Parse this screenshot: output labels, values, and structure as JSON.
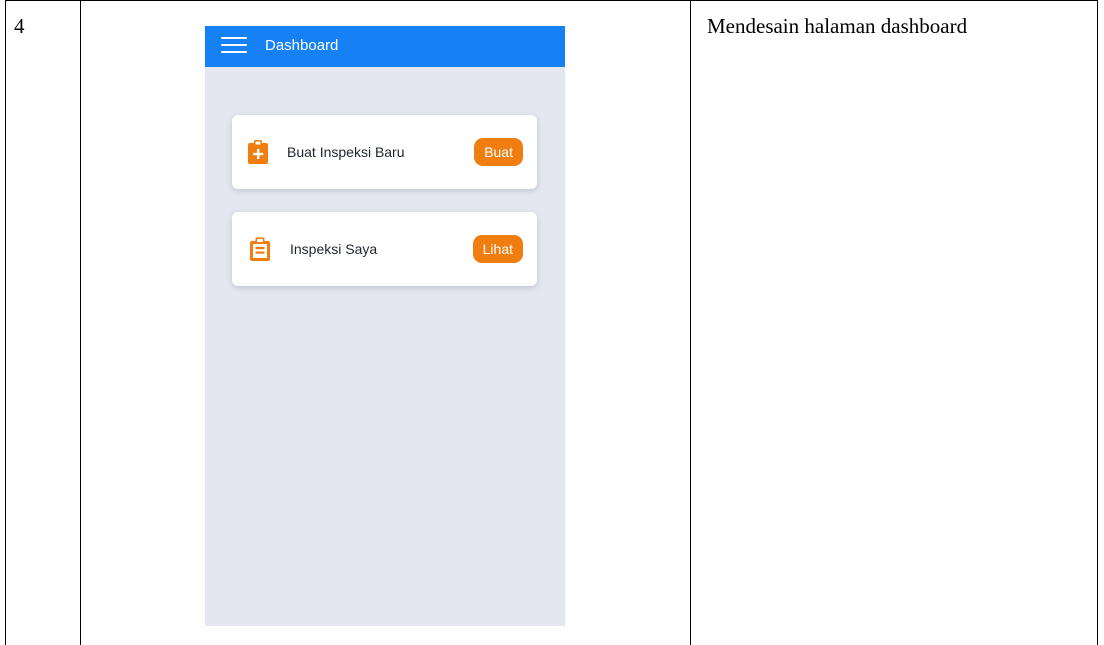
{
  "table": {
    "row_number": "4",
    "description": "Mendesain halaman dashboard"
  },
  "app": {
    "title": "Dashboard",
    "menu_icon": "hamburger-menu-icon",
    "colors": {
      "appbar": "#1681f5",
      "background": "#e4e7ef",
      "accent": "#f07d0f"
    }
  },
  "cards": [
    {
      "icon": "clipboard-plus-icon",
      "label": "Buat Inspeksi Baru",
      "button_label": "Buat"
    },
    {
      "icon": "clipboard-list-icon",
      "label": "Inspeksi Saya",
      "button_label": "Lihat"
    }
  ]
}
